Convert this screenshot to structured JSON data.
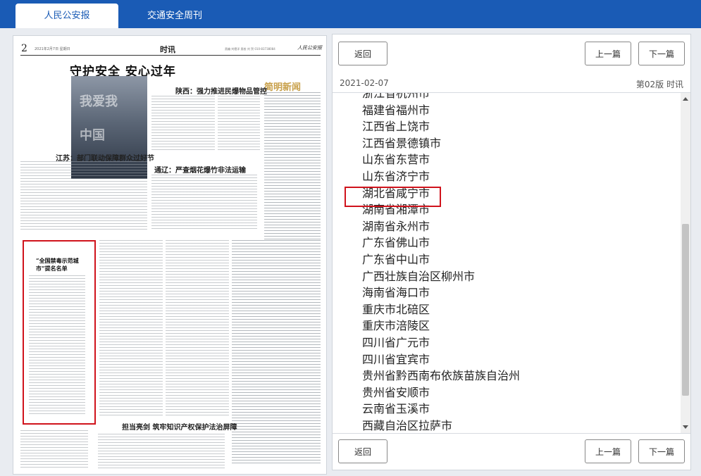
{
  "tabs": [
    {
      "label": "人民公安报",
      "active": true
    },
    {
      "label": "交通安全周刊",
      "active": false
    }
  ],
  "newspaper": {
    "page_number": "2",
    "date_line": "2021年2月7日 星期日",
    "section": "时讯",
    "meta": "责编 刘德洋 责校 刘 贺 010-83738084",
    "logo": "人民公安报",
    "headline": "守护安全 安心过年",
    "brief_title": "简明新闻",
    "photo_words": [
      "我爱我",
      "中国"
    ],
    "subheads": [
      "陕西：强力推进民爆物品管控",
      "江苏：部门联动保障群众过好节",
      "通辽：严查烟花爆竹非法运输",
      "担当亮剑 筑牢知识产权保护法治屏障"
    ],
    "box_title": "“全国禁毒示范城市”提名名单"
  },
  "toolbar": {
    "back_label": "返回",
    "prev_label": "上一篇",
    "next_label": "下一篇"
  },
  "article": {
    "date": "2021-02-07",
    "page_label": "第02版 时讯"
  },
  "cities": [
    "浙江省杭州市",
    "福建省福州市",
    "江西省上饶市",
    "江西省景德镇市",
    "山东省东营市",
    "山东省济宁市",
    "湖北省咸宁市",
    "湖南省湘潭市",
    "湖南省永州市",
    "广东省佛山市",
    "广东省中山市",
    "广西壮族自治区柳州市",
    "海南省海口市",
    "重庆市北碚区",
    "重庆市涪陵区",
    "四川省广元市",
    "四川省宜宾市",
    "贵州省黔西南布依族苗族自治州",
    "贵州省安顺市",
    "云南省玉溪市",
    "西藏自治区拉萨市"
  ],
  "highlighted_city_index": 6,
  "colors": {
    "brand_blue": "#1a5bb5",
    "highlight_red": "#d0131c",
    "page_bg": "#e9ecf1"
  }
}
